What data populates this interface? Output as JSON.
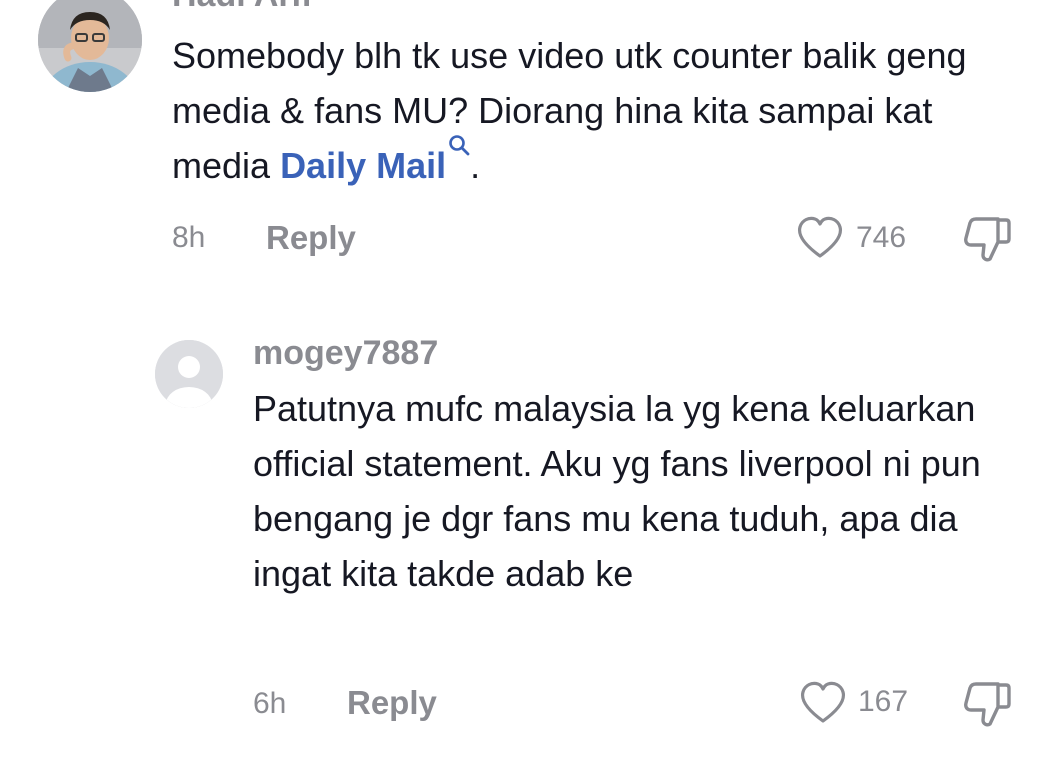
{
  "comments": [
    {
      "username": "Hadi Arif",
      "text_before_link": "Somebody blh tk use video utk counter balik geng media & fans MU? Diorang hina kita sampai kat media ",
      "link_text": "Daily Mail",
      "text_after_link": ".",
      "time": "8h",
      "reply_label": "Reply",
      "like_count": "746",
      "avatar": "user-photo",
      "link_color": "#3a62b8"
    },
    {
      "username": "mogey7887",
      "text": "Patutnya mufc malaysia la yg kena keluarkan official statement. Aku yg fans liverpool ni pun bengang je dgr fans mu kena tuduh, apa dia ingat kita takde adab ke",
      "time": "6h",
      "reply_label": "Reply",
      "like_count": "167",
      "avatar": "default-avatar"
    }
  ],
  "icons": {
    "like": "heart-outline-icon",
    "dislike": "thumbs-down-outline-icon",
    "search": "search-icon"
  },
  "colors": {
    "text": "#161823",
    "muted": "#8a8b91",
    "link": "#3a62b8"
  }
}
